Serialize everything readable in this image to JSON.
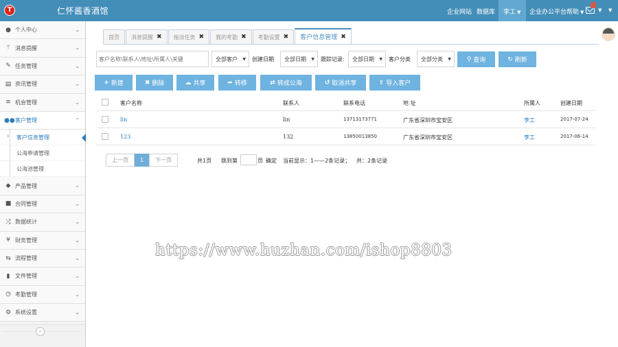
{
  "header": {
    "logo_letter": "T",
    "title": "仁怀酱香酒馆",
    "links": [
      "企业网站",
      "数据库"
    ],
    "user": "李工",
    "help": "企业办公平台帮助",
    "colors": {
      "bar": "#438eb9",
      "user_bg": "#62a8d1"
    }
  },
  "sidebar": {
    "items": [
      {
        "label": "个人中心",
        "icon": "user-icon"
      },
      {
        "label": "消息提醒",
        "icon": "bell-icon"
      },
      {
        "label": "任务管理",
        "icon": "edit-icon"
      },
      {
        "label": "资讯管理",
        "icon": "newspaper-icon"
      },
      {
        "label": "机会管理",
        "icon": "list-icon"
      },
      {
        "label": "客户管理",
        "icon": "users-icon"
      },
      {
        "label": "产品管理",
        "icon": "dropbox-icon"
      },
      {
        "label": "合同管理",
        "icon": "folder-open-icon"
      },
      {
        "label": "数据统计",
        "icon": "random-icon"
      },
      {
        "label": "财务管理",
        "icon": "yen-icon"
      },
      {
        "label": "流程管理",
        "icon": "retweet-icon"
      },
      {
        "label": "文件管理",
        "icon": "file-icon"
      },
      {
        "label": "考勤管理",
        "icon": "clock-icon"
      },
      {
        "label": "系统设置",
        "icon": "gear-icon"
      }
    ],
    "sub_items": [
      "客户信息管理",
      "公海申请管理",
      "公海池管理"
    ]
  },
  "tabs": [
    {
      "label": "首页",
      "closable": false
    },
    {
      "label": "消息提醒",
      "closable": true
    },
    {
      "label": "指派任务",
      "closable": true
    },
    {
      "label": "我的考勤",
      "closable": true
    },
    {
      "label": "考勤设置",
      "closable": true
    },
    {
      "label": "客户信息管理",
      "closable": true,
      "active": true
    }
  ],
  "filters": {
    "search_placeholder": "客户名称\\联系人\\地址\\所属人\\关键",
    "customer_select": "全部客户",
    "create_date_label": "创建日期",
    "create_date_select": "全部日期",
    "follow_label": "跟踪记录:",
    "follow_select": "全部日期",
    "category_label": "客户分类",
    "category_select": "全部分类",
    "query_button": "查询",
    "refresh_button": "刷新"
  },
  "actions": [
    "新建",
    "删除",
    "共享",
    "转移",
    "转成公海",
    "取消共享",
    "导入客户"
  ],
  "table": {
    "columns": [
      "客户名称",
      "联系人",
      "联系电话",
      "地 址",
      "所属人",
      "创建日期"
    ],
    "rows": [
      {
        "name": "lin",
        "contact": "lin",
        "phone": "13713173771",
        "address": "广东省深圳市宝安区",
        "owner": "李工",
        "created": "2017-07-24"
      },
      {
        "name": "123",
        "contact": "132",
        "phone": "13850013850",
        "address": "广东省深圳市宝安区",
        "owner": "李工",
        "created": "2017-06-14"
      }
    ]
  },
  "pager": {
    "prev": "上一页",
    "current": "1",
    "next": "下一页",
    "total_pages": "共1页",
    "jump_to": "跳到第",
    "page_unit": "页",
    "confirm": "确定",
    "display": "当前显示：1——2条记录；",
    "total": "共：2条记录"
  },
  "watermark": "https://www.huzhan.com/ishop8803"
}
